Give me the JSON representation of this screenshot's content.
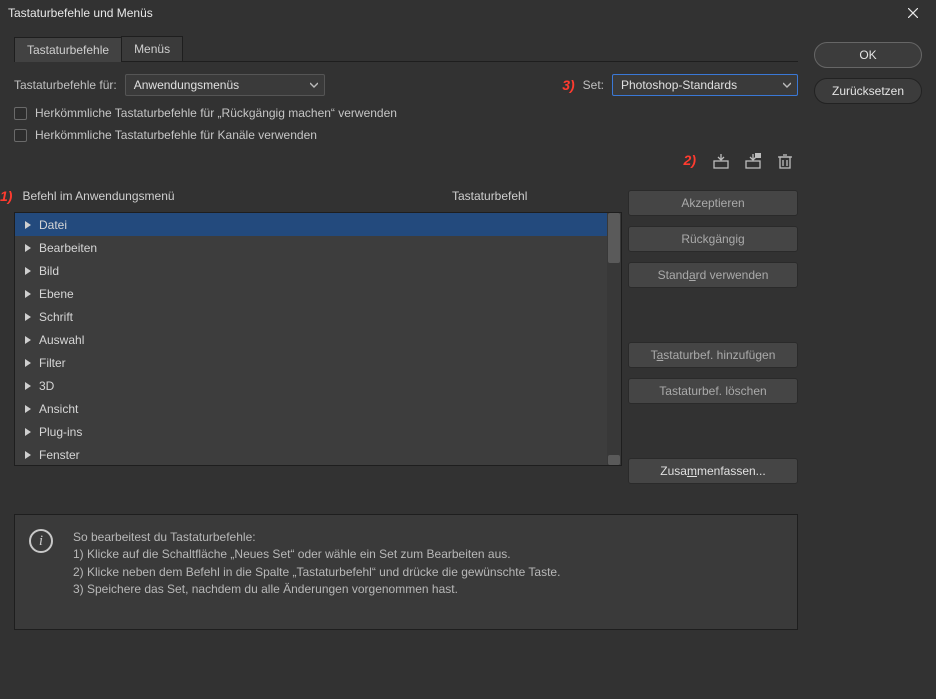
{
  "title": "Tastaturbefehle und Menüs",
  "tabs": {
    "shortcuts": "Tastaturbefehle",
    "menus": "Menüs"
  },
  "row1": {
    "label": "Tastaturbefehle für:",
    "select1": "Anwendungsmenüs",
    "setlabel": "Set:",
    "select2": "Photoshop-Standards"
  },
  "checks": {
    "c1": "Herkömmliche Tastaturbefehle für „Rückgängig machen“ verwenden",
    "c2": "Herkömmliche Tastaturbefehle für Kanäle verwenden"
  },
  "annotations": {
    "a1": "1)",
    "a2": "2)",
    "a3": "3)"
  },
  "headers": {
    "cmd": "Befehl im Anwendungsmenü",
    "shortcut": "Tastaturbefehl"
  },
  "menuitems": [
    "Datei",
    "Bearbeiten",
    "Bild",
    "Ebene",
    "Schrift",
    "Auswahl",
    "Filter",
    "3D",
    "Ansicht",
    "Plug-ins",
    "Fenster"
  ],
  "sidebuttons": {
    "ok": "OK",
    "reset": "Zurücksetzen",
    "accept": "Akzeptieren",
    "undo": "Rückgängig",
    "usedefault": "Standard verwenden",
    "addshort": "Tastaturbef. hinzufügen",
    "delshort": "Tastaturbef. löschen",
    "summarize": "Zusammenfassen..."
  },
  "info": {
    "title": "So bearbeitest du Tastaturbefehle:",
    "l1": "1) Klicke auf die Schaltfläche „Neues Set“ oder wähle ein Set zum Bearbeiten aus.",
    "l2": "2) Klicke neben dem Befehl in die Spalte „Tastaturbefehl“ und drücke die gewünschte Taste.",
    "l3": "3) Speichere das Set, nachdem du alle Änderungen vorgenommen hast."
  }
}
